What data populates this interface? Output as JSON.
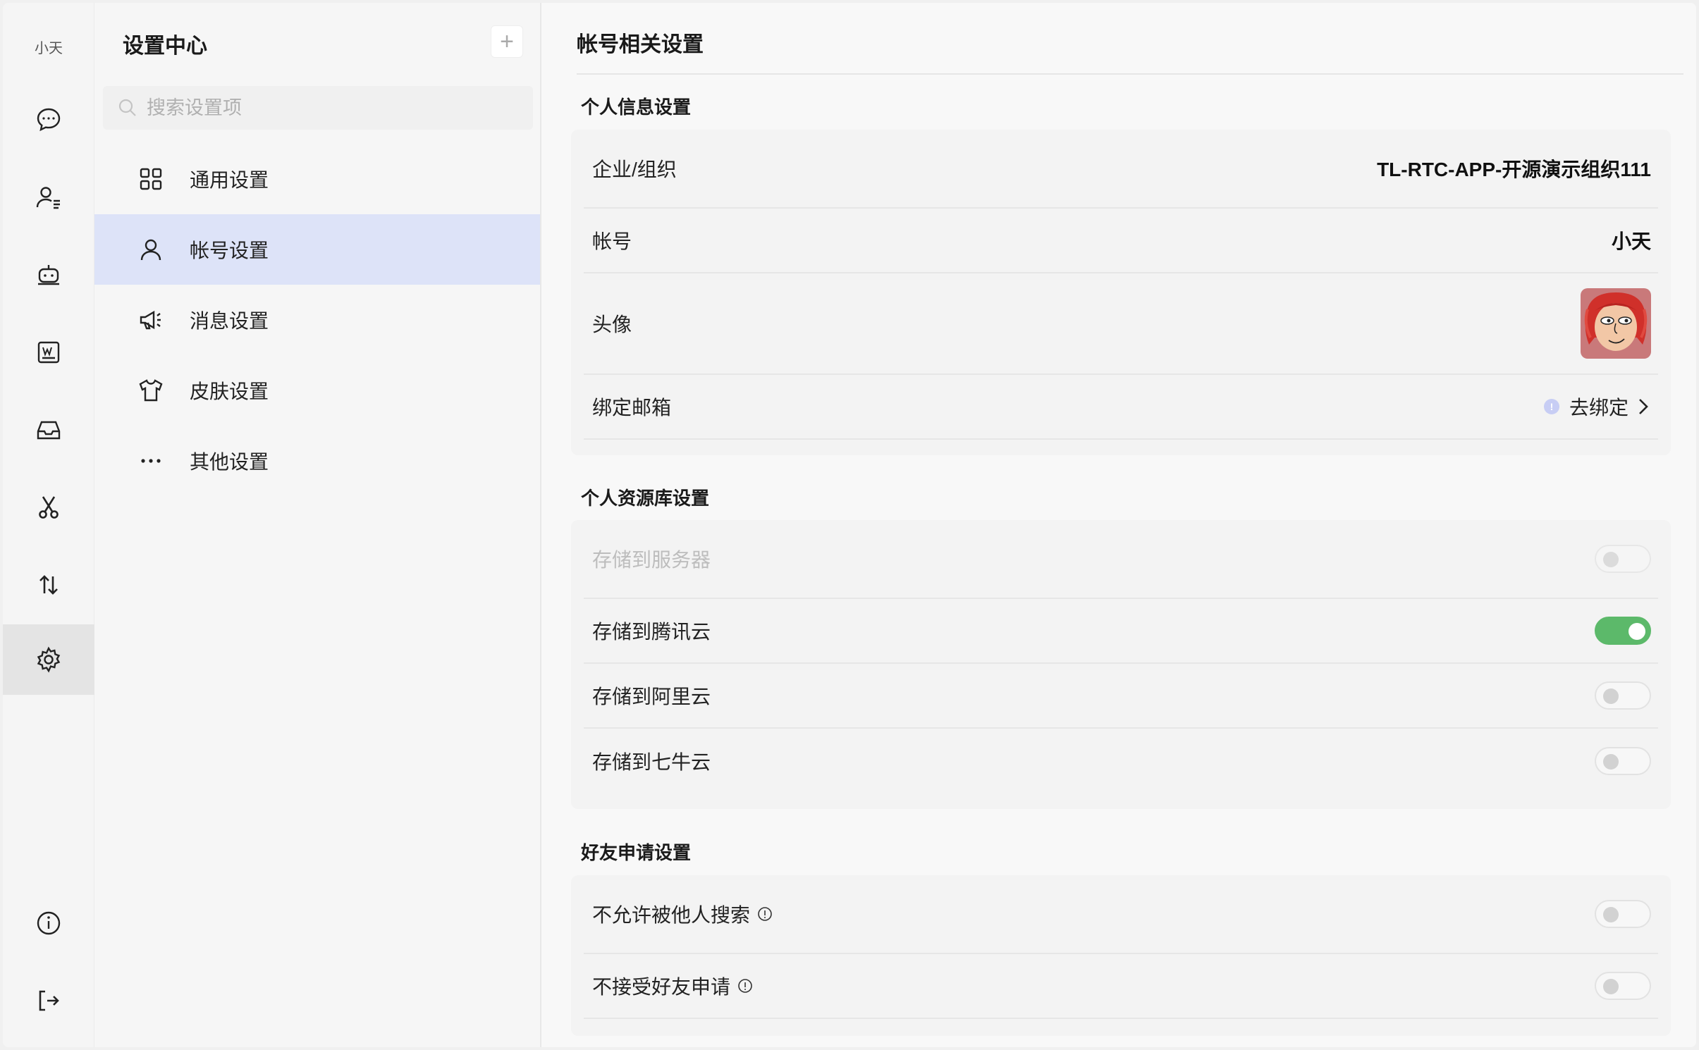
{
  "rail": {
    "user_name": "小天",
    "items": [
      {
        "icon": "chat-bubble-icon"
      },
      {
        "icon": "contacts-icon"
      },
      {
        "icon": "robot-icon"
      },
      {
        "icon": "document-w-icon"
      },
      {
        "icon": "inbox-icon"
      },
      {
        "icon": "scissors-icon"
      },
      {
        "icon": "transfer-arrows-icon"
      },
      {
        "icon": "gear-icon",
        "active": true
      }
    ],
    "bottom": [
      {
        "icon": "info-icon"
      },
      {
        "icon": "logout-icon"
      }
    ]
  },
  "sidebar": {
    "title": "设置中心",
    "add_label": "+",
    "search_placeholder": "搜索设置项",
    "items": [
      {
        "label": "通用设置",
        "icon": "grid-icon"
      },
      {
        "label": "帐号设置",
        "icon": "user-icon",
        "active": true
      },
      {
        "label": "消息设置",
        "icon": "megaphone-icon"
      },
      {
        "label": "皮肤设置",
        "icon": "tshirt-icon"
      },
      {
        "label": "其他设置",
        "icon": "more-dots-icon"
      }
    ]
  },
  "content": {
    "title": "帐号相关设置",
    "personal": {
      "title": "个人信息设置",
      "org_label": "企业/组织",
      "org_value": "TL-RTC-APP-开源演示组织111",
      "account_label": "帐号",
      "account_value": "小天",
      "avatar_label": "头像",
      "email_label": "绑定邮箱",
      "email_action": "去绑定"
    },
    "storage": {
      "title": "个人资源库设置",
      "items": [
        {
          "label": "存储到服务器",
          "on": false,
          "disabled": true
        },
        {
          "label": "存储到腾讯云",
          "on": true,
          "disabled": false
        },
        {
          "label": "存储到阿里云",
          "on": false,
          "disabled": false
        },
        {
          "label": "存储到七牛云",
          "on": false,
          "disabled": false
        }
      ]
    },
    "friend": {
      "title": "好友申请设置",
      "items": [
        {
          "label": "不允许被他人搜索",
          "on": false
        },
        {
          "label": "不接受好友申请",
          "on": false
        }
      ]
    }
  },
  "colors": {
    "accent_active_bg": "#dde3f8",
    "toggle_on": "#5cb96a"
  }
}
